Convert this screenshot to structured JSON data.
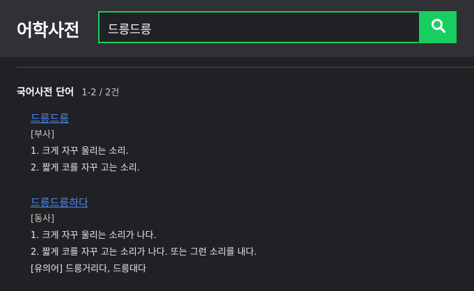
{
  "app": {
    "logo": "어학사전"
  },
  "search": {
    "value": "드릉드릉",
    "button_icon": "search-icon"
  },
  "results": {
    "section_title": "국어사전 단어",
    "section_count": "1-2 / 2건",
    "entries": [
      {
        "word": "드릉드릉",
        "pos": "[부사]",
        "definitions": [
          "1. 크게 자꾸 울리는 소리.",
          "2. 짧게 코를 자꾸 고는 소리."
        ]
      },
      {
        "word": "드릉드릉하다",
        "pos": "[동사]",
        "definitions": [
          "1. 크게 자꾸 울리는 소리가 나다.",
          "2. 짧게 코를 자꾸 고는 소리가 나다. 또는 그런 소리를 내다."
        ],
        "synonyms": "[유의어] 드릉거리다, 드릉대다"
      }
    ]
  },
  "colors": {
    "accent": "#19ce60",
    "link": "#4d8af0",
    "background": "#202124",
    "header_bg": "#303134"
  }
}
